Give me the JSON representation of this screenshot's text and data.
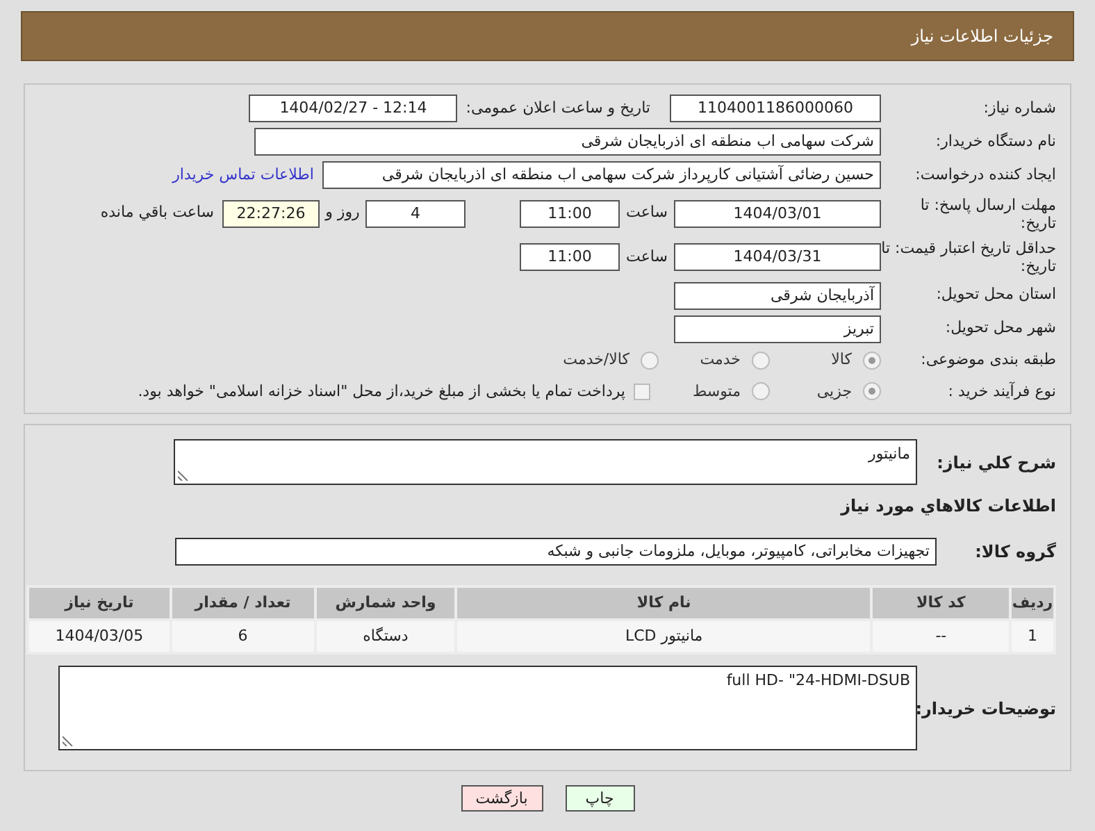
{
  "header": {
    "title": "جزئیات اطلاعات نیاز"
  },
  "details": {
    "need_number": {
      "label": "شماره نیاز:",
      "value": "1104001186000060"
    },
    "announce": {
      "label": "تاریخ و ساعت اعلان عمومی:",
      "value": "1404/02/27 - 12:14"
    },
    "buyer": {
      "label": "نام دستگاه خریدار:",
      "value": "شرکت سهامی اب منطقه ای اذربایجان شرقی"
    },
    "creator": {
      "label": "ایجاد کننده درخواست:",
      "value": "حسین رضائی آشتیانی کارپرداز شرکت سهامی اب منطقه ای اذربایجان شرقی",
      "link": "اطلاعات تماس خریدار"
    },
    "deadline": {
      "label": "مهلت ارسال پاسخ: تا تاریخ:",
      "date": "1404/03/01",
      "time_label": "ساعت",
      "time": "11:00",
      "days": "4",
      "days_label": "روز و",
      "remaining": "22:27:26",
      "remaining_label": "ساعت باقي مانده"
    },
    "validity": {
      "label": "حداقل تاریخ اعتبار قیمت: تا تاریخ:",
      "date": "1404/03/31",
      "time_label": "ساعت",
      "time": "11:00"
    },
    "province": {
      "label": "استان محل تحویل:",
      "value": "آذربایجان شرقی"
    },
    "city": {
      "label": "شهر محل تحویل:",
      "value": "تبریز"
    },
    "category": {
      "label": "طبقه بندی موضوعی:",
      "options": [
        {
          "label": "کالا",
          "selected": true
        },
        {
          "label": "خدمت",
          "selected": false
        },
        {
          "label": "کالا/خدمت",
          "selected": false
        }
      ]
    },
    "process": {
      "label": "نوع فرآیند خرید :",
      "options": [
        {
          "label": "جزیی",
          "selected": true
        },
        {
          "label": "متوسط",
          "selected": false
        }
      ],
      "treasury": {
        "label": "پرداخت تمام یا بخشی از مبلغ خرید،از محل \"اسناد خزانه اسلامی\" خواهد بود.",
        "checked": false
      }
    }
  },
  "items": {
    "description": {
      "label": "شرح کلي نياز:",
      "value": "مانیتور"
    },
    "section_title": "اطلاعات کالاهاي مورد نياز",
    "group": {
      "label": "گروه کالا:",
      "value": "تجهیزات مخابراتی، کامپیوتر، موبایل، ملزومات جانبی و شبکه"
    },
    "table": {
      "columns": [
        "ردیف",
        "کد کالا",
        "نام کالا",
        "واحد شمارش",
        "تعداد / مقدار",
        "تاریخ نیاز"
      ],
      "rows": [
        [
          "1",
          "--",
          "مانیتور LCD",
          "دستگاه",
          "6",
          "1404/03/05"
        ]
      ]
    },
    "notes": {
      "label": "توضیحات خریدار:",
      "value": "full HD- \"24-HDMI-DSUB"
    }
  },
  "buttons": [
    {
      "label": "چاپ",
      "kind": "print"
    },
    {
      "label": "بازگشت",
      "kind": "back"
    }
  ]
}
